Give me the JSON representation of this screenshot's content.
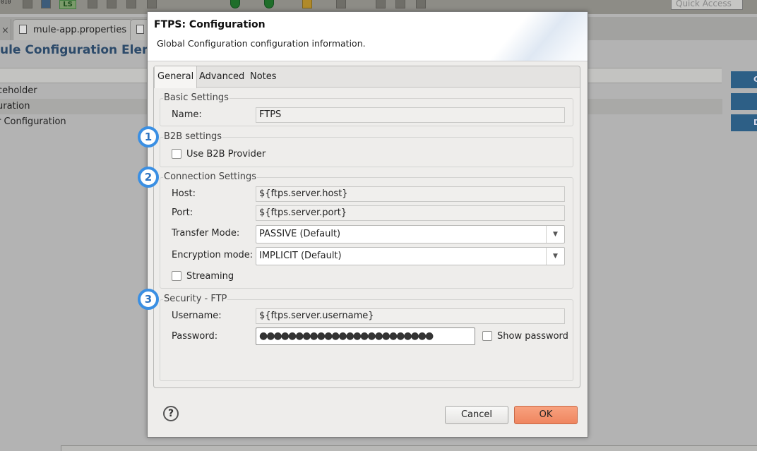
{
  "background": {
    "quick_access_placeholder": "Quick Access",
    "tab_label": "mule-app.properties",
    "ls_label": "LS",
    "toolbar_010": "010",
    "heading": "ule Configuration Eleme",
    "rows": [
      {
        "label": "ceholder"
      },
      {
        "label": "uration"
      },
      {
        "label": "r Configuration"
      }
    ],
    "side_buttons": [
      "C",
      "",
      "D"
    ]
  },
  "dialog": {
    "title": "FTPS: Configuration",
    "subtitle": "Global Configuration configuration information.",
    "tabs": [
      {
        "label": "General",
        "active": true
      },
      {
        "label": "Advanced",
        "active": false
      },
      {
        "label": "Notes",
        "active": false
      }
    ],
    "basic_settings": {
      "legend": "Basic Settings",
      "name_label": "Name:",
      "name_value": "FTPS"
    },
    "b2b_settings": {
      "marker": "1",
      "legend": "B2B settings",
      "use_b2b_label": "Use B2B Provider",
      "use_b2b_checked": false
    },
    "connection_settings": {
      "marker": "2",
      "legend": "Connection Settings",
      "host_label": "Host:",
      "host_value": "${ftps.server.host}",
      "port_label": "Port:",
      "port_value": "${ftps.server.port}",
      "transfer_mode_label": "Transfer Mode:",
      "transfer_mode_value": "PASSIVE (Default)",
      "encryption_mode_label": "Encryption mode:",
      "encryption_mode_value": "IMPLICIT (Default)",
      "streaming_label": "Streaming",
      "streaming_checked": false
    },
    "security_ftp": {
      "marker": "3",
      "legend": "Security - FTP",
      "username_label": "Username:",
      "username_value": "${ftps.server.username}",
      "password_label": "Password:",
      "password_mask": "●●●●●●●●●●●●●●●●●●●●●●●●",
      "show_password_label": "Show password",
      "show_password_checked": false
    },
    "help_glyph": "?",
    "cancel_label": "Cancel",
    "ok_label": "OK"
  },
  "colors": {
    "marker_blue": "#3a8fe3",
    "ok_button": "#f3906b",
    "overlay_gray": "#b3b3b3"
  },
  "icons": [
    "help-icon",
    "dropdown-arrow-icon",
    "file-icon",
    "close-icon"
  ]
}
